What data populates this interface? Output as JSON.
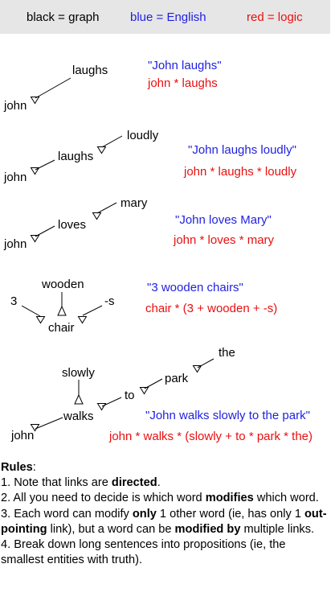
{
  "legend": {
    "black": "black = graph",
    "blue": "blue = English",
    "red": "red = logic",
    "colors": {
      "graph": "#000000",
      "english": "#1f1fe0",
      "logic": "#e81010",
      "bar": "#e6e6e6"
    }
  },
  "examples": [
    {
      "words": [
        "john",
        "laughs"
      ],
      "english": "\"John laughs\"",
      "logic": "john * laughs"
    },
    {
      "words": [
        "john",
        "laughs",
        "loudly"
      ],
      "english": "\"John laughs loudly\"",
      "logic": "john * laughs * loudly"
    },
    {
      "words": [
        "john",
        "loves",
        "mary"
      ],
      "english": "\"John loves Mary\"",
      "logic": "john * loves * mary"
    },
    {
      "words": [
        "3",
        "wooden",
        "-s",
        "chair"
      ],
      "english": "\"3 wooden chairs\"",
      "logic": "chair * (3 + wooden + -s)"
    },
    {
      "words": [
        "john",
        "walks",
        "slowly",
        "to",
        "park",
        "the"
      ],
      "english": "\"John walks slowly to the park\"",
      "logic": "john * walks * (slowly + to * park * the)"
    }
  ],
  "rules": {
    "heading": "Rules",
    "colon": ":",
    "r1": {
      "a": "1.  Note that links are ",
      "b": "directed",
      "c": "."
    },
    "r2": {
      "a": "2.  All you need to decide is which word ",
      "b": "modifies",
      "c": " which word."
    },
    "r3": {
      "a": "3.  Each word can modify ",
      "b": "only",
      "c": " 1 other word (ie, has only 1 ",
      "d": "out-pointing",
      "e": " link), but a word can be ",
      "f": "modified by",
      "g": " multiple links."
    },
    "r4": {
      "a": "4.  Break down long sentences into propositions (ie, the smallest entities with truth)."
    }
  }
}
